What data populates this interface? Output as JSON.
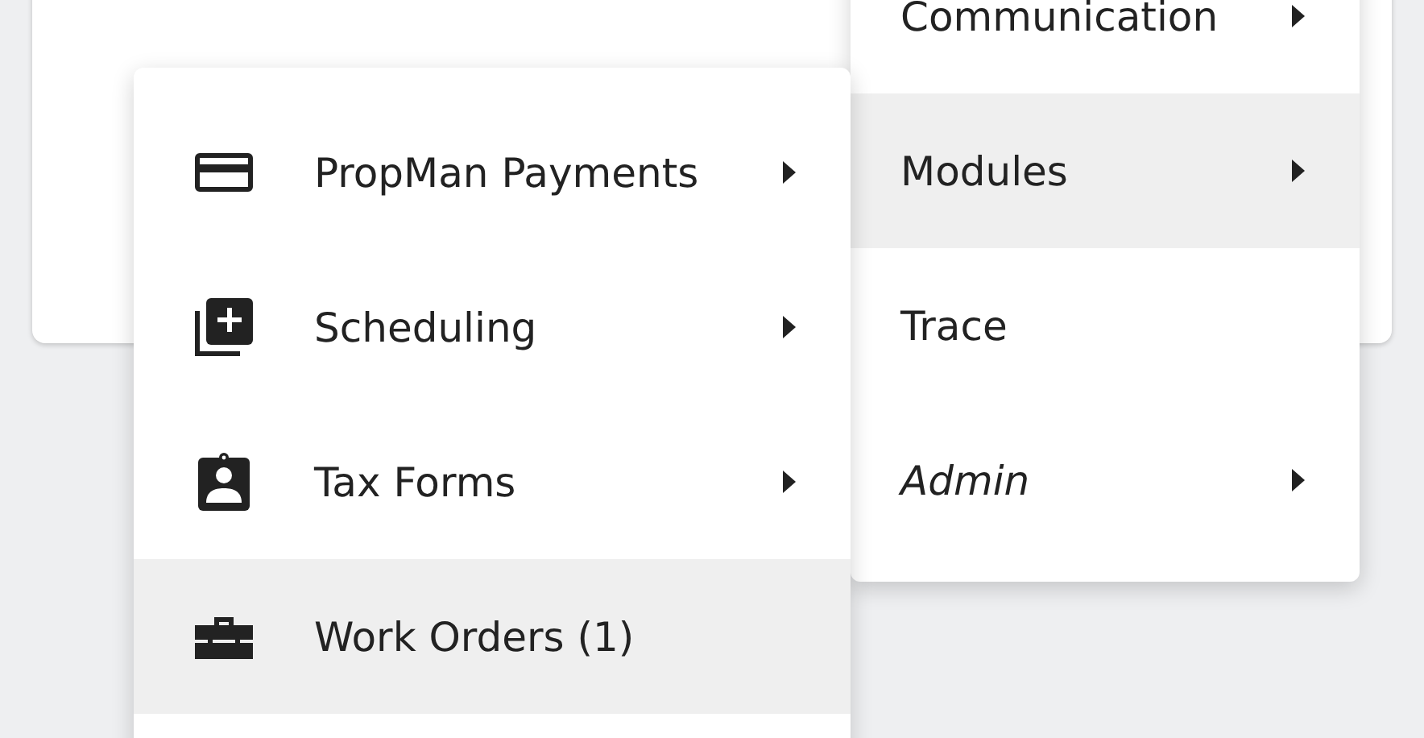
{
  "main_menu": {
    "items": [
      {
        "label": "Communication",
        "has_submenu": true,
        "selected": false,
        "italic": false
      },
      {
        "label": "Modules",
        "has_submenu": true,
        "selected": true,
        "italic": false
      },
      {
        "label": "Trace",
        "has_submenu": false,
        "selected": false,
        "italic": false
      },
      {
        "label": "Admin",
        "has_submenu": true,
        "selected": false,
        "italic": true
      }
    ]
  },
  "submenu": {
    "items": [
      {
        "label": "PropMan Payments",
        "has_submenu": true,
        "selected": false
      },
      {
        "label": "Scheduling",
        "has_submenu": true,
        "selected": false
      },
      {
        "label": "Tax Forms",
        "has_submenu": true,
        "selected": false
      },
      {
        "label": "Work Orders (1)",
        "has_submenu": false,
        "selected": true
      }
    ]
  }
}
